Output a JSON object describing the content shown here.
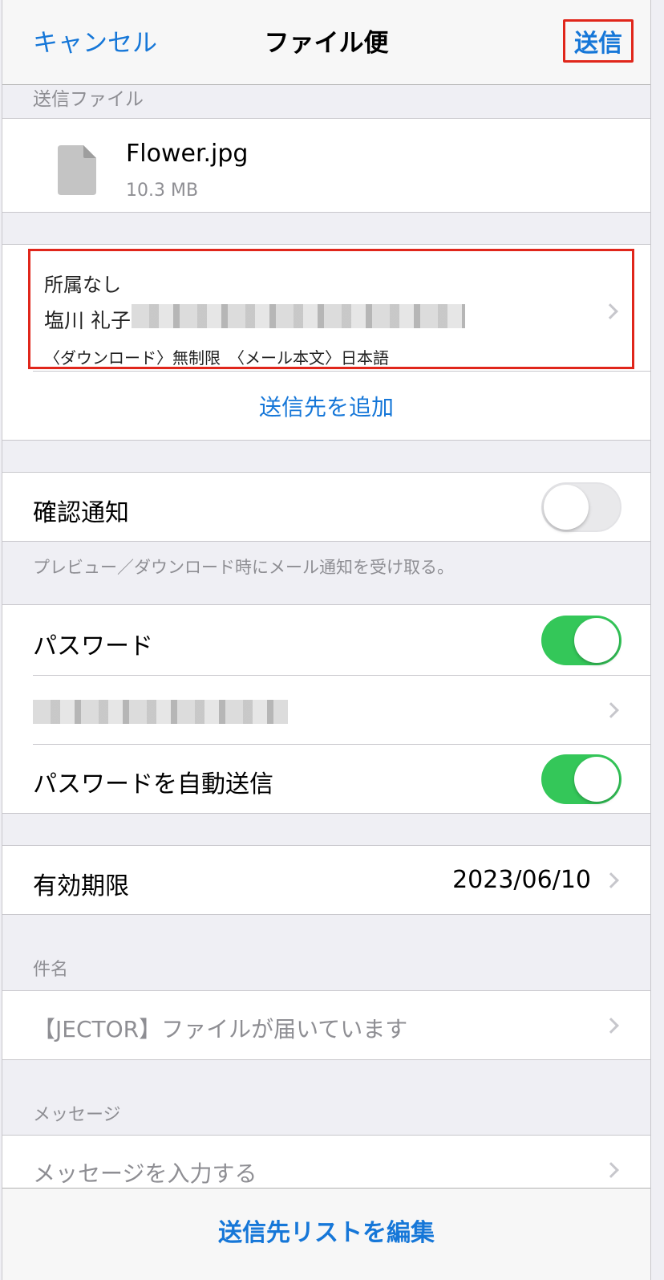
{
  "nav": {
    "cancel": "キャンセル",
    "title": "ファイル便",
    "send": "送信"
  },
  "send_file": {
    "header": "送信ファイル",
    "file_name": "Flower.jpg",
    "file_size": "10.3 MB",
    "icon": "document-icon"
  },
  "recipient": {
    "group": "所属なし",
    "name": "塩川 礼子",
    "details": "〈ダウンロード〉無制限　〈メール本文〉日本語",
    "add_label": "送信先を追加"
  },
  "confirm": {
    "label": "確認通知",
    "enabled": false,
    "footer": "プレビュー／ダウンロード時にメール通知を受け取る。"
  },
  "password": {
    "label": "パスワード",
    "enabled": true,
    "auto_send_label": "パスワードを自動送信",
    "auto_send_enabled": true
  },
  "expiry": {
    "label": "有効期限",
    "value": "2023/06/10"
  },
  "subject": {
    "header": "件名",
    "value": "【JECTOR】ファイルが届いています"
  },
  "message": {
    "header": "メッセージ",
    "placeholder": "メッセージを入力する"
  },
  "footer": {
    "edit_list": "送信先リストを編集"
  },
  "colors": {
    "accent": "#1677d8",
    "toggle_on": "#34c759",
    "highlight": "#e0261b"
  }
}
